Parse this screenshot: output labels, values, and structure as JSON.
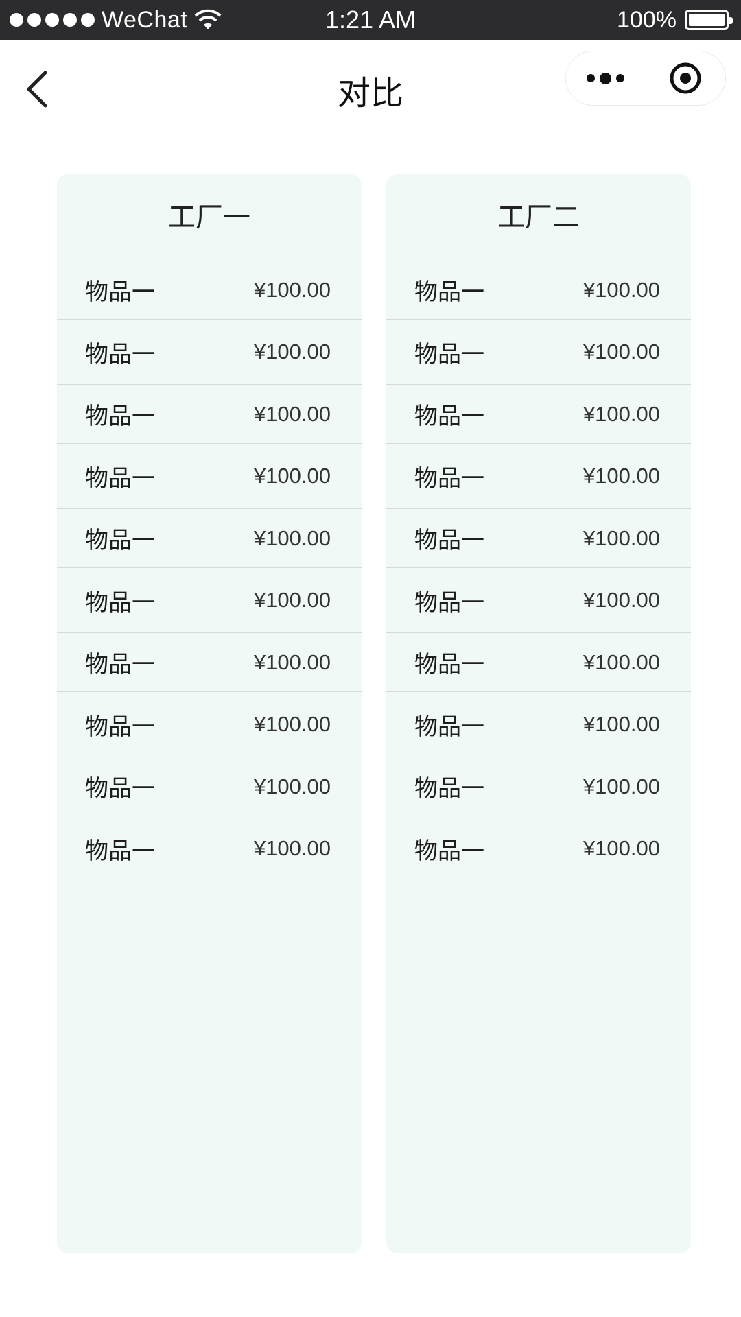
{
  "status_bar": {
    "carrier": "WeChat",
    "time": "1:21 AM",
    "battery_percent": "100%",
    "battery_level": 1.0
  },
  "nav": {
    "title": "对比",
    "back_icon": "chevron-left-icon",
    "more_icon": "more-dots-icon",
    "close_icon": "target-circle-icon"
  },
  "columns": [
    {
      "title": "工厂一",
      "items": [
        {
          "name": "物品一",
          "price": "¥100.00"
        },
        {
          "name": "物品一",
          "price": "¥100.00"
        },
        {
          "name": "物品一",
          "price": "¥100.00"
        },
        {
          "name": "物品一",
          "price": "¥100.00"
        },
        {
          "name": "物品一",
          "price": "¥100.00"
        },
        {
          "name": "物品一",
          "price": "¥100.00"
        },
        {
          "name": "物品一",
          "price": "¥100.00"
        },
        {
          "name": "物品一",
          "price": "¥100.00"
        },
        {
          "name": "物品一",
          "price": "¥100.00"
        },
        {
          "name": "物品一",
          "price": "¥100.00"
        }
      ]
    },
    {
      "title": "工厂二",
      "items": [
        {
          "name": "物品一",
          "price": "¥100.00"
        },
        {
          "name": "物品一",
          "price": "¥100.00"
        },
        {
          "name": "物品一",
          "price": "¥100.00"
        },
        {
          "name": "物品一",
          "price": "¥100.00"
        },
        {
          "name": "物品一",
          "price": "¥100.00"
        },
        {
          "name": "物品一",
          "price": "¥100.00"
        },
        {
          "name": "物品一",
          "price": "¥100.00"
        },
        {
          "name": "物品一",
          "price": "¥100.00"
        },
        {
          "name": "物品一",
          "price": "¥100.00"
        },
        {
          "name": "物品一",
          "price": "¥100.00"
        }
      ]
    }
  ],
  "colors": {
    "status_bar_bg": "#2c2c2e",
    "column_bg": "#f1f9f6",
    "divider": "#d6dcd9"
  }
}
